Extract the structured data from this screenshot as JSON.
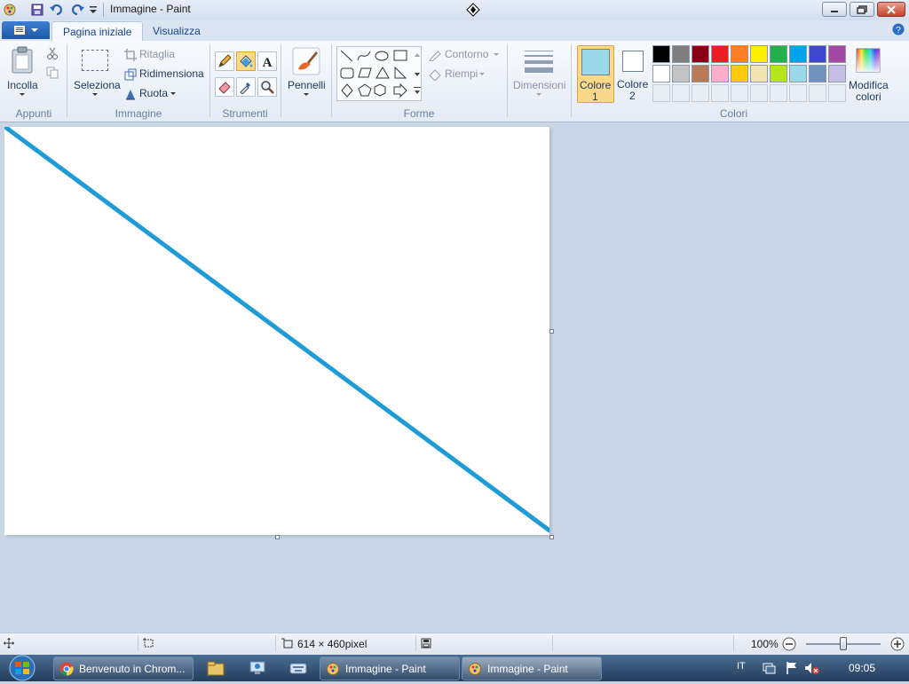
{
  "window": {
    "title": "Immagine - Paint"
  },
  "tabs": [
    {
      "label": "Pagina iniziale",
      "active": true
    },
    {
      "label": "Visualizza",
      "active": false
    }
  ],
  "clipboard": {
    "paste_label": "Incolla",
    "group_label": "Appunti"
  },
  "image": {
    "select_label": "Seleziona",
    "crop_label": "Ritaglia",
    "resize_label": "Ridimensiona",
    "rotate_label": "Ruota",
    "group_label": "Immagine"
  },
  "tools": {
    "group_label": "Strumenti"
  },
  "brushes": {
    "label": "Pennelli"
  },
  "shapes": {
    "outline_label": "Contorno",
    "fill_label": "Riempi",
    "group_label": "Forme"
  },
  "size": {
    "label": "Dimensioni"
  },
  "colors": {
    "color1_label": "Colore",
    "color1_num": "1",
    "color2_label": "Colore",
    "color2_num": "2",
    "edit_label1": "Modifica",
    "edit_label2": "colori",
    "group_label": "Colori",
    "color1_value": "#99d9ea",
    "color2_value": "#ffffff",
    "palette_row1": [
      "#000000",
      "#7f7f7f",
      "#880015",
      "#ed1c24",
      "#ff7f27",
      "#fff200",
      "#22b14c",
      "#00a2e8",
      "#3f48cc",
      "#a349a4"
    ],
    "palette_row2": [
      "#ffffff",
      "#c3c3c3",
      "#b97a57",
      "#ffaec9",
      "#ffc90e",
      "#efe4b0",
      "#b5e61d",
      "#99d9ea",
      "#7092be",
      "#c8bfe7"
    ]
  },
  "canvas": {
    "line_color": "#1f9bd6"
  },
  "status": {
    "dimensions": "614 × 460pixel",
    "zoom": "100%"
  },
  "taskbar": {
    "chrome_label": "Benvenuto in Chrom...",
    "paint1_label": "Immagine - Paint",
    "paint2_label": "Immagine - Paint",
    "lang": "IT",
    "clock": "09:05"
  }
}
